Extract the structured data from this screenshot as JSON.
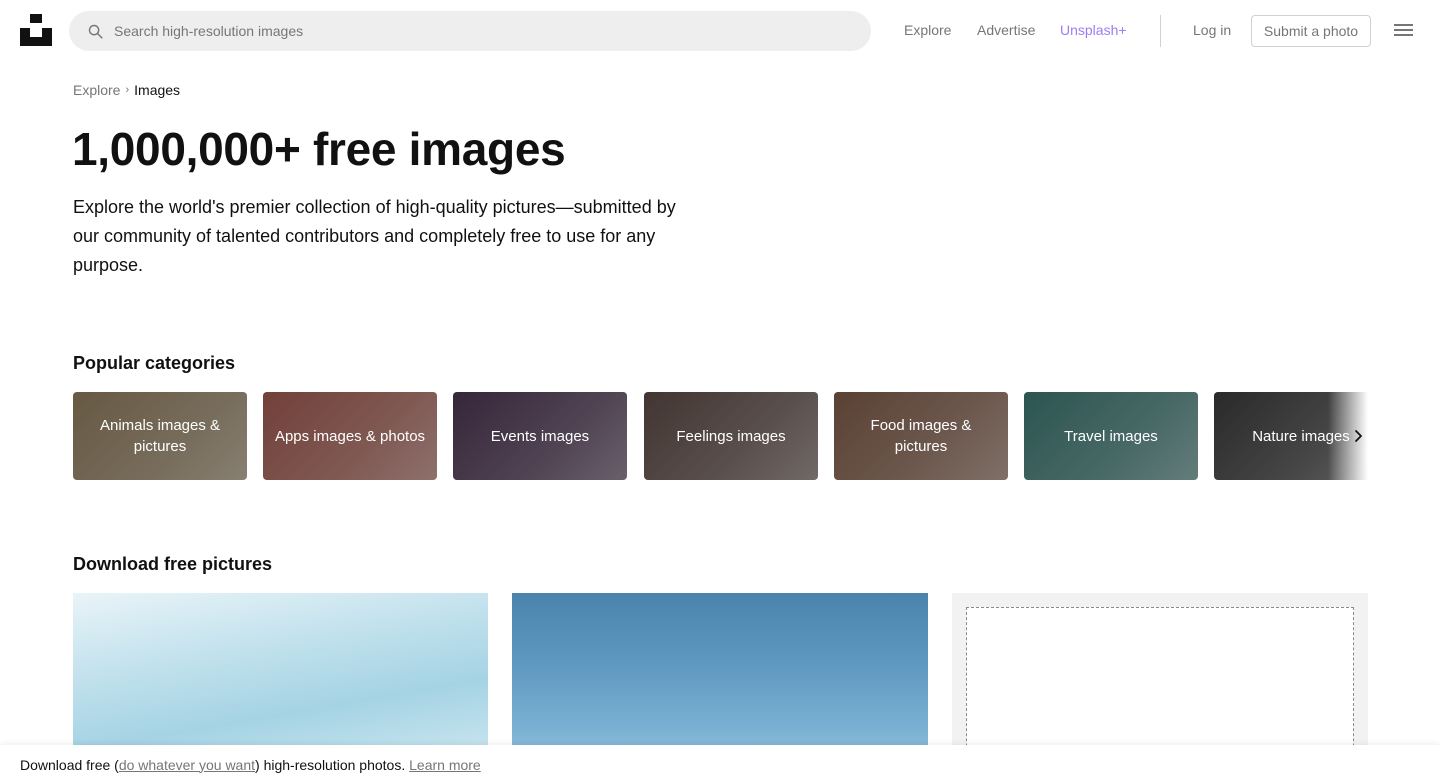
{
  "header": {
    "search_placeholder": "Search high-resolution images",
    "nav": {
      "explore": "Explore",
      "advertise": "Advertise",
      "unsplash_plus": "Unsplash+",
      "login": "Log in",
      "submit": "Submit a photo"
    },
    "icons": [
      "unsplash-logo-icon",
      "search-icon",
      "hamburger-menu-icon"
    ],
    "colors": {
      "plus_accent": "#9d7df3"
    }
  },
  "breadcrumb": {
    "parent": "Explore",
    "separator": "›",
    "current": "Images"
  },
  "hero": {
    "title": "1,000,000+ free images",
    "description": "Explore the world's premier collection of high-quality pictures—submitted by our community of talented contributors and completely free to use for any purpose."
  },
  "categories": {
    "title": "Popular categories",
    "items": [
      {
        "label": "Animals images & pictures",
        "color": "#8f7c5e"
      },
      {
        "label": "Apps images & photos",
        "color": "#9e5a50"
      },
      {
        "label": "Events images",
        "color": "#4b3550"
      },
      {
        "label": "Feelings images",
        "color": "#5c4a45"
      },
      {
        "label": "Food images & pictures",
        "color": "#7d5a48"
      },
      {
        "label": "Travel images",
        "color": "#3d7671"
      },
      {
        "label": "Nature images",
        "color": "#3a3a3a"
      }
    ],
    "next_icon": "chevron-right-icon"
  },
  "download": {
    "title": "Download free pictures"
  },
  "footer": {
    "prefix": "Download free (",
    "link": "do whatever you want",
    "middle": ") high-resolution photos. ",
    "learn_more": "Learn more"
  }
}
